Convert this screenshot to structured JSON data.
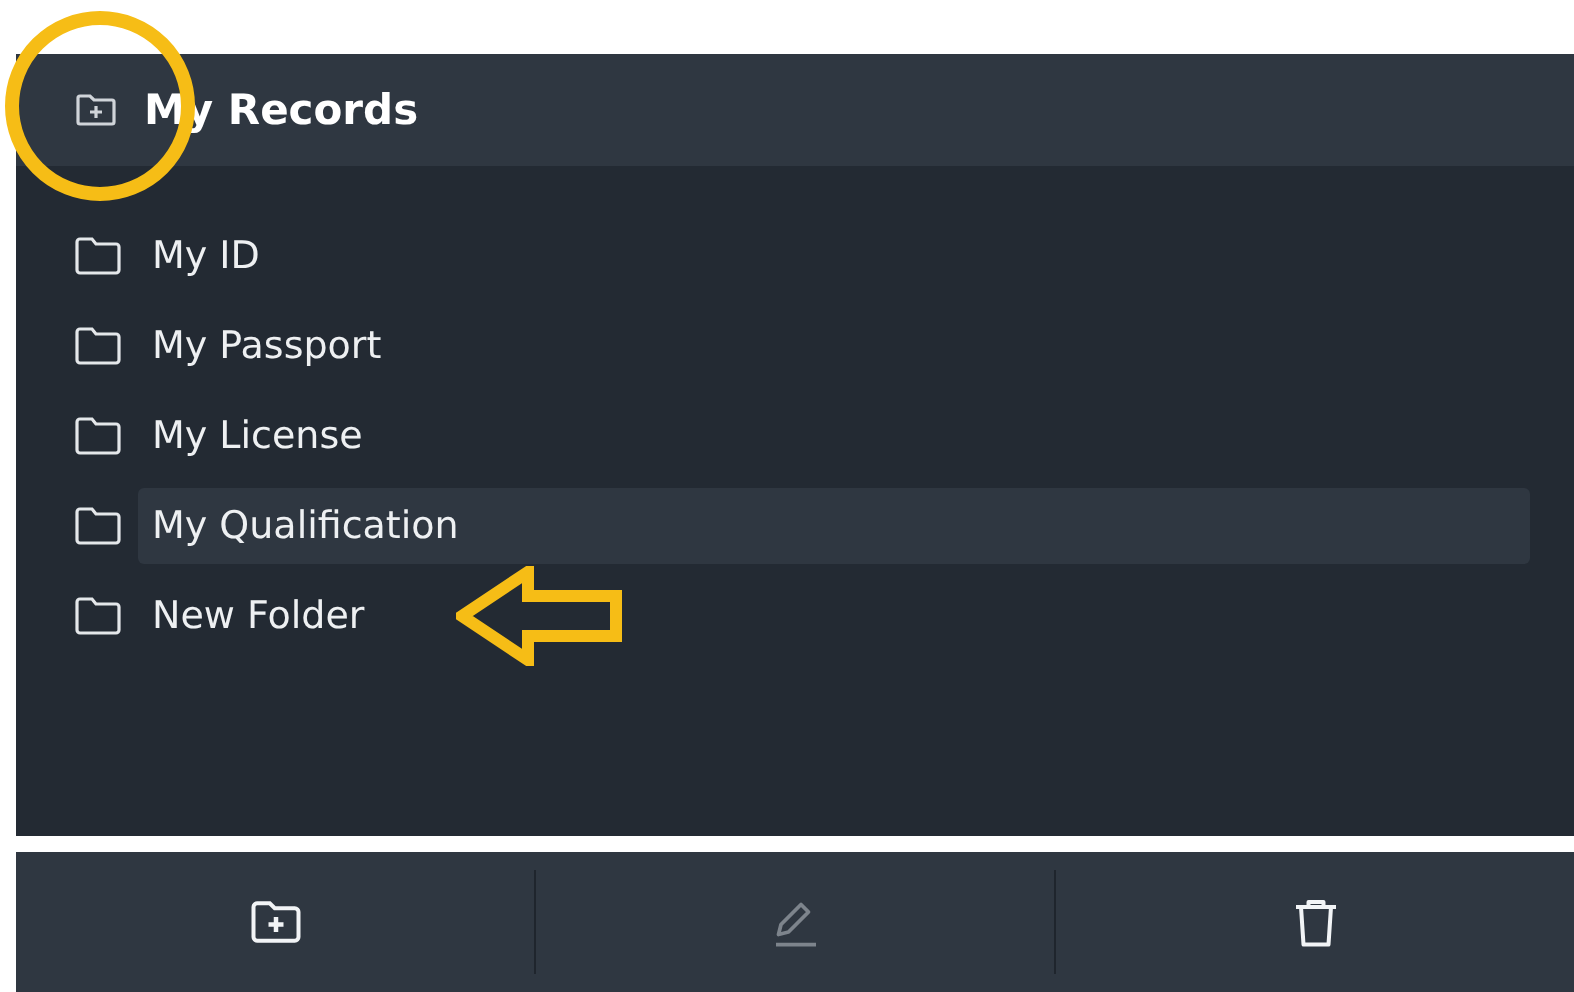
{
  "header": {
    "title": "My Records"
  },
  "folders": [
    {
      "label": "My ID",
      "selected": false
    },
    {
      "label": "My Passport",
      "selected": false
    },
    {
      "label": "My License",
      "selected": false
    },
    {
      "label": "My Qualification",
      "selected": true
    },
    {
      "label": "New Folder",
      "selected": false
    }
  ],
  "toolbar": [
    {
      "kind": "add-folder",
      "disabled": false
    },
    {
      "kind": "edit",
      "disabled": true
    },
    {
      "kind": "delete",
      "disabled": false
    }
  ]
}
